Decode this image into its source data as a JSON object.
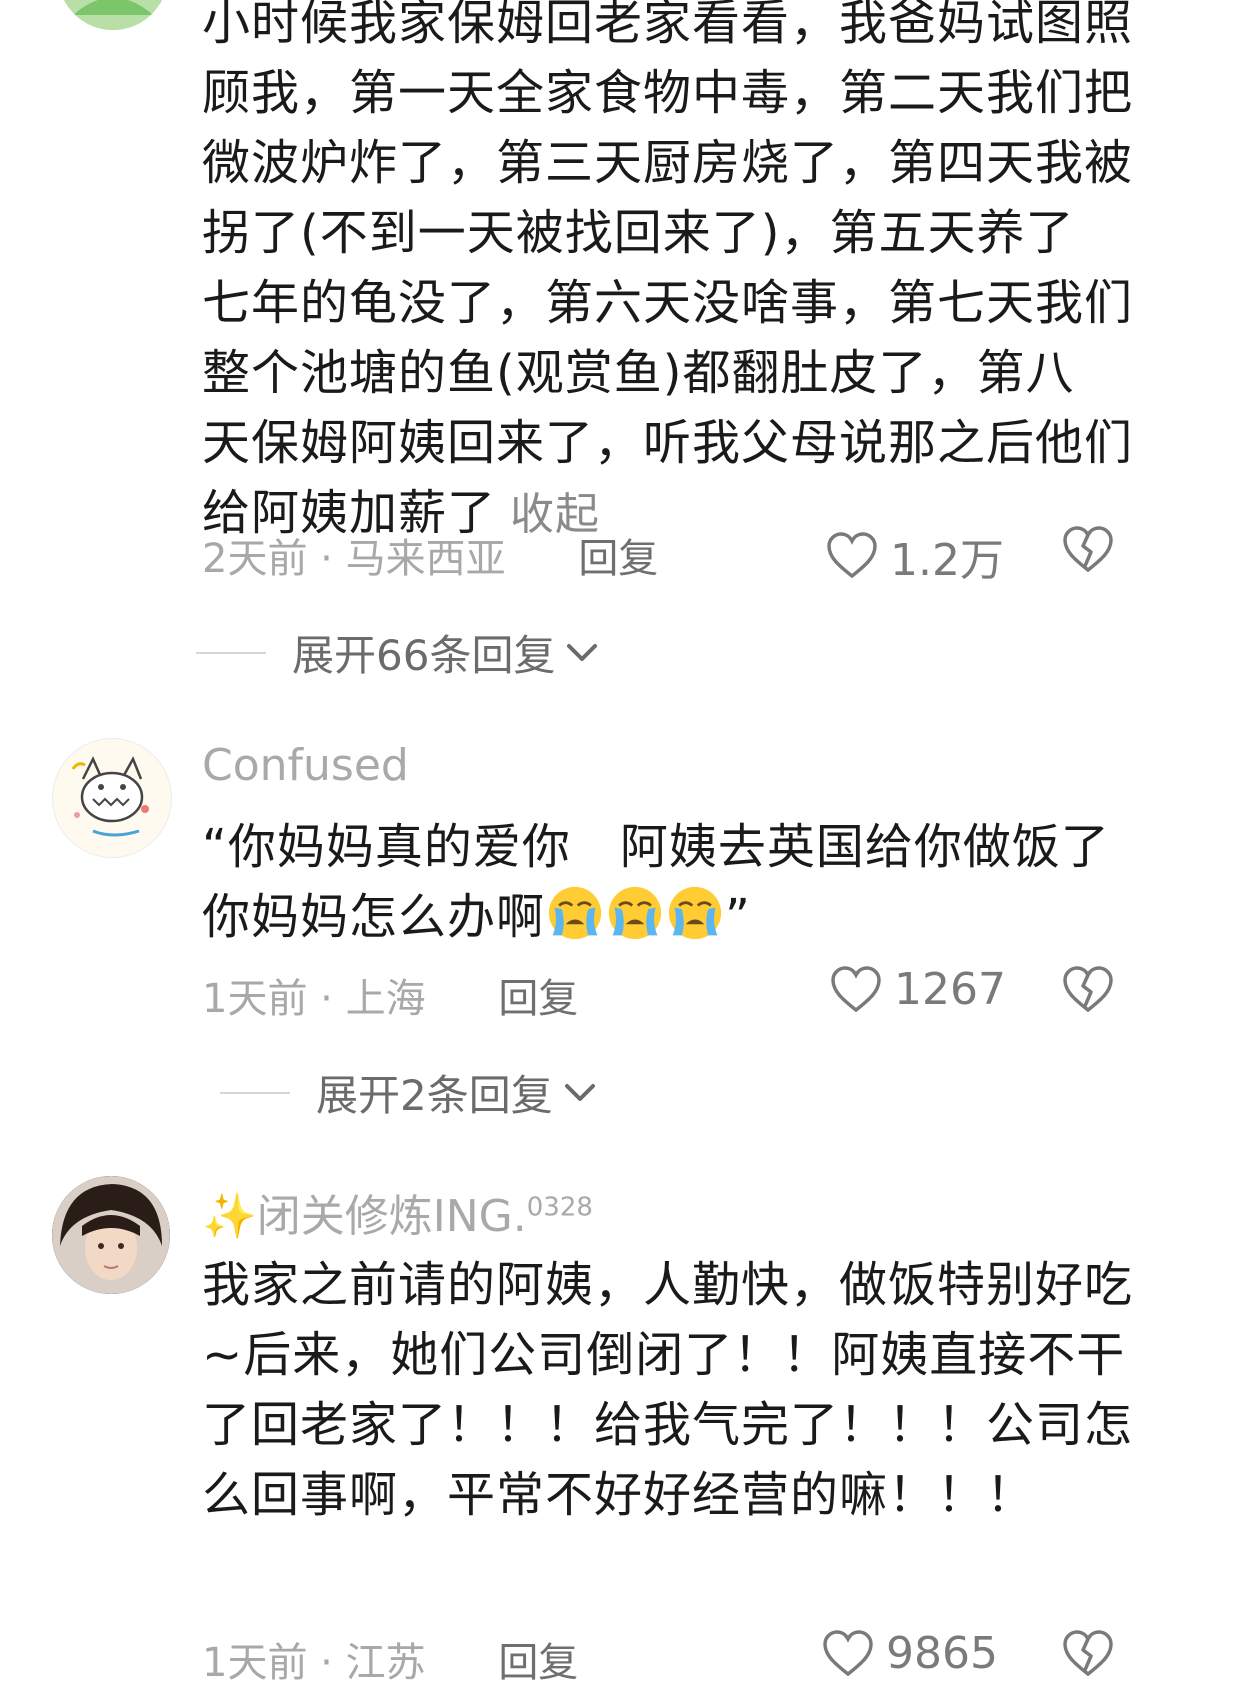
{
  "comments": [
    {
      "lines": [
        "小时候我家保姆回老家看看，我爸妈试图照",
        "顾我，第一天全家食物中毒，第二天我们把",
        "微波炉炸了，第三天厨房烧了，第四天我被",
        "拐了(不到一天被找回来了)，第五天养了",
        "七年的龟没了，第六天没啥事，第七天我们",
        "整个池塘的鱼(观赏鱼)都翻肚皮了，第八",
        "天保姆阿姨回来了，听我父母说那之后他们",
        "给阿姨加薪了"
      ],
      "collapse_label": "收起",
      "meta": "2天前 · 马来西亚",
      "reply_label": "回复",
      "likes": "1.2万",
      "expand_label": "展开66条回复"
    },
    {
      "username": "Confused",
      "line1": "“你妈妈真的爱你　阿姨去英国给你做饭了",
      "line2": "你妈妈怎么办啊",
      "line2_end": "”",
      "emoji": "loudly-crying-face",
      "meta": "1天前 · 上海",
      "reply_label": "回复",
      "likes": "1267",
      "expand_label": "展开2条回复"
    },
    {
      "username": "✨闭关修炼ING.",
      "username_sup": "0328",
      "lines": [
        "我家之前请的阿姨，人勤快，做饭特别好吃",
        "~后来，她们公司倒闭了！！阿姨直接不干",
        "了回老家了！！！给我气完了！！！公司怎",
        "么回事啊，平常不好好经营的嘛！！！"
      ],
      "meta": "1天前 · 江苏",
      "reply_label": "回复",
      "likes": "9865"
    }
  ],
  "icons": {
    "like": "heart-outline-icon",
    "dislike": "broken-heart-icon",
    "expand": "chevron-down-icon"
  }
}
